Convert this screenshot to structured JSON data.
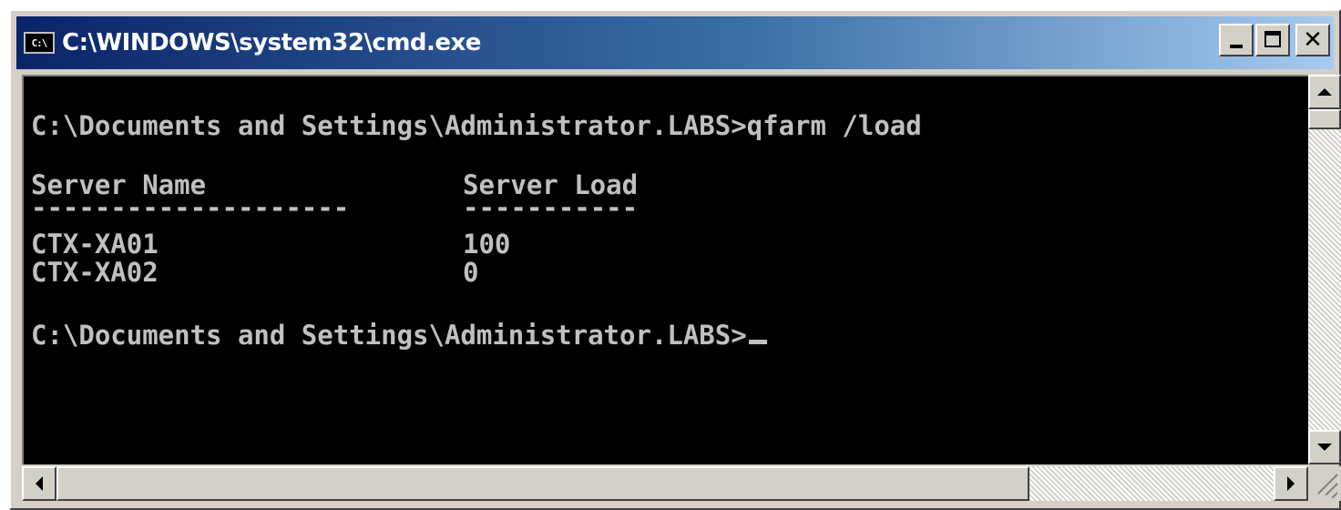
{
  "window": {
    "title": "C:\\WINDOWS\\system32\\cmd.exe",
    "icon_text": "C:\\",
    "icon": "cmd-icon",
    "buttons": {
      "minimize": "minimize-icon",
      "maximize": "maximize-icon",
      "close_label": "✕"
    }
  },
  "console": {
    "command_line": "C:\\Documents and Settings\\Administrator.LABS>qfarm /load",
    "table": {
      "headers": [
        "Server Name",
        "Server Load"
      ],
      "separators": [
        "--------------------",
        "-----------"
      ],
      "rows": [
        {
          "name": "CTX-XA01",
          "load": "100"
        },
        {
          "name": "CTX-XA02",
          "load": "0"
        }
      ]
    },
    "prompt": "C:\\Documents and Settings\\Administrator.LABS>"
  },
  "colors": {
    "console_bg": "#000000",
    "console_fg": "#c0c0c0",
    "titlebar_start": "#0a246a",
    "titlebar_end": "#a6caf0",
    "chrome": "#d4d0c8"
  }
}
